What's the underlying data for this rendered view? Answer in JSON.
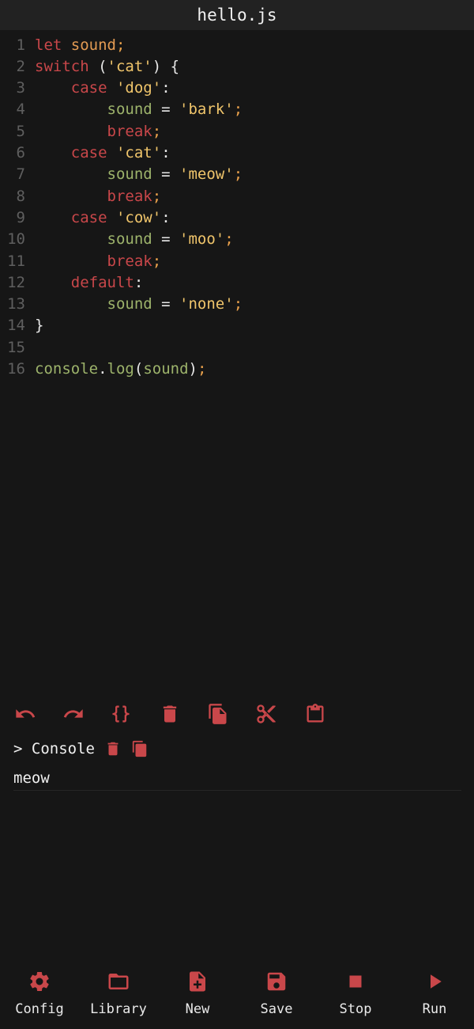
{
  "window": {
    "title": "hello.js"
  },
  "theme": {
    "background": "#161616",
    "titlebar": "#222222",
    "accent": "#c9474a",
    "keyword": "#c9474a",
    "variable": "#9db36b",
    "string": "#f0c56b",
    "line_number": "#5f5f5f"
  },
  "editor": {
    "lines": [
      {
        "n": "1",
        "tokens": [
          [
            "kw",
            "let"
          ],
          [
            "pun",
            " "
          ],
          [
            "var-or",
            "sound"
          ],
          [
            "semi",
            ";"
          ]
        ]
      },
      {
        "n": "2",
        "tokens": [
          [
            "kw",
            "switch"
          ],
          [
            "pun",
            " ("
          ],
          [
            "str",
            "'cat'"
          ],
          [
            "pun",
            ") {"
          ]
        ]
      },
      {
        "n": "3",
        "tokens": [
          [
            "pun",
            "    "
          ],
          [
            "kw",
            "case"
          ],
          [
            "pun",
            " "
          ],
          [
            "str",
            "'dog'"
          ],
          [
            "pun",
            ":"
          ]
        ]
      },
      {
        "n": "4",
        "tokens": [
          [
            "pun",
            "        "
          ],
          [
            "var",
            "sound"
          ],
          [
            "pun",
            " = "
          ],
          [
            "str",
            "'bark'"
          ],
          [
            "semi",
            ";"
          ]
        ]
      },
      {
        "n": "5",
        "tokens": [
          [
            "pun",
            "        "
          ],
          [
            "kw",
            "break"
          ],
          [
            "semi",
            ";"
          ]
        ]
      },
      {
        "n": "6",
        "tokens": [
          [
            "pun",
            "    "
          ],
          [
            "kw",
            "case"
          ],
          [
            "pun",
            " "
          ],
          [
            "str",
            "'cat'"
          ],
          [
            "pun",
            ":"
          ]
        ]
      },
      {
        "n": "7",
        "tokens": [
          [
            "pun",
            "        "
          ],
          [
            "var",
            "sound"
          ],
          [
            "pun",
            " = "
          ],
          [
            "str",
            "'meow'"
          ],
          [
            "semi",
            ";"
          ]
        ]
      },
      {
        "n": "8",
        "tokens": [
          [
            "pun",
            "        "
          ],
          [
            "kw",
            "break"
          ],
          [
            "semi",
            ";"
          ]
        ]
      },
      {
        "n": "9",
        "tokens": [
          [
            "pun",
            "    "
          ],
          [
            "kw",
            "case"
          ],
          [
            "pun",
            " "
          ],
          [
            "str",
            "'cow'"
          ],
          [
            "pun",
            ":"
          ]
        ]
      },
      {
        "n": "10",
        "tokens": [
          [
            "pun",
            "        "
          ],
          [
            "var",
            "sound"
          ],
          [
            "pun",
            " = "
          ],
          [
            "str",
            "'moo'"
          ],
          [
            "semi",
            ";"
          ]
        ]
      },
      {
        "n": "11",
        "tokens": [
          [
            "pun",
            "        "
          ],
          [
            "kw",
            "break"
          ],
          [
            "semi",
            ";"
          ]
        ]
      },
      {
        "n": "12",
        "tokens": [
          [
            "pun",
            "    "
          ],
          [
            "kw",
            "default"
          ],
          [
            "pun",
            ":"
          ]
        ]
      },
      {
        "n": "13",
        "tokens": [
          [
            "pun",
            "        "
          ],
          [
            "var",
            "sound"
          ],
          [
            "pun",
            " = "
          ],
          [
            "str",
            "'none'"
          ],
          [
            "semi",
            ";"
          ]
        ]
      },
      {
        "n": "14",
        "tokens": [
          [
            "pun",
            "}"
          ]
        ]
      },
      {
        "n": "15",
        "tokens": []
      },
      {
        "n": "16",
        "tokens": [
          [
            "var",
            "console"
          ],
          [
            "pun",
            "."
          ],
          [
            "var",
            "log"
          ],
          [
            "pun",
            "("
          ],
          [
            "var",
            "sound"
          ],
          [
            "pun",
            ")"
          ],
          [
            "semi",
            ";"
          ]
        ]
      }
    ]
  },
  "toolbar": {
    "items": [
      {
        "name": "undo",
        "icon": "undo-icon"
      },
      {
        "name": "redo",
        "icon": "redo-icon"
      },
      {
        "name": "format",
        "icon": "braces-icon"
      },
      {
        "name": "delete",
        "icon": "trash-icon"
      },
      {
        "name": "copy",
        "icon": "copy-icon"
      },
      {
        "name": "cut",
        "icon": "scissors-icon"
      },
      {
        "name": "paste",
        "icon": "clipboard-icon"
      }
    ]
  },
  "console": {
    "title": "> Console",
    "clear_icon": "trash-icon",
    "copy_icon": "copy-icon",
    "output": "meow"
  },
  "bottom_nav": {
    "items": [
      {
        "label": "Config",
        "icon": "gear-icon"
      },
      {
        "label": "Library",
        "icon": "folder-icon"
      },
      {
        "label": "New",
        "icon": "new-file-icon"
      },
      {
        "label": "Save",
        "icon": "save-icon"
      },
      {
        "label": "Stop",
        "icon": "stop-icon"
      },
      {
        "label": "Run",
        "icon": "play-icon"
      }
    ]
  }
}
